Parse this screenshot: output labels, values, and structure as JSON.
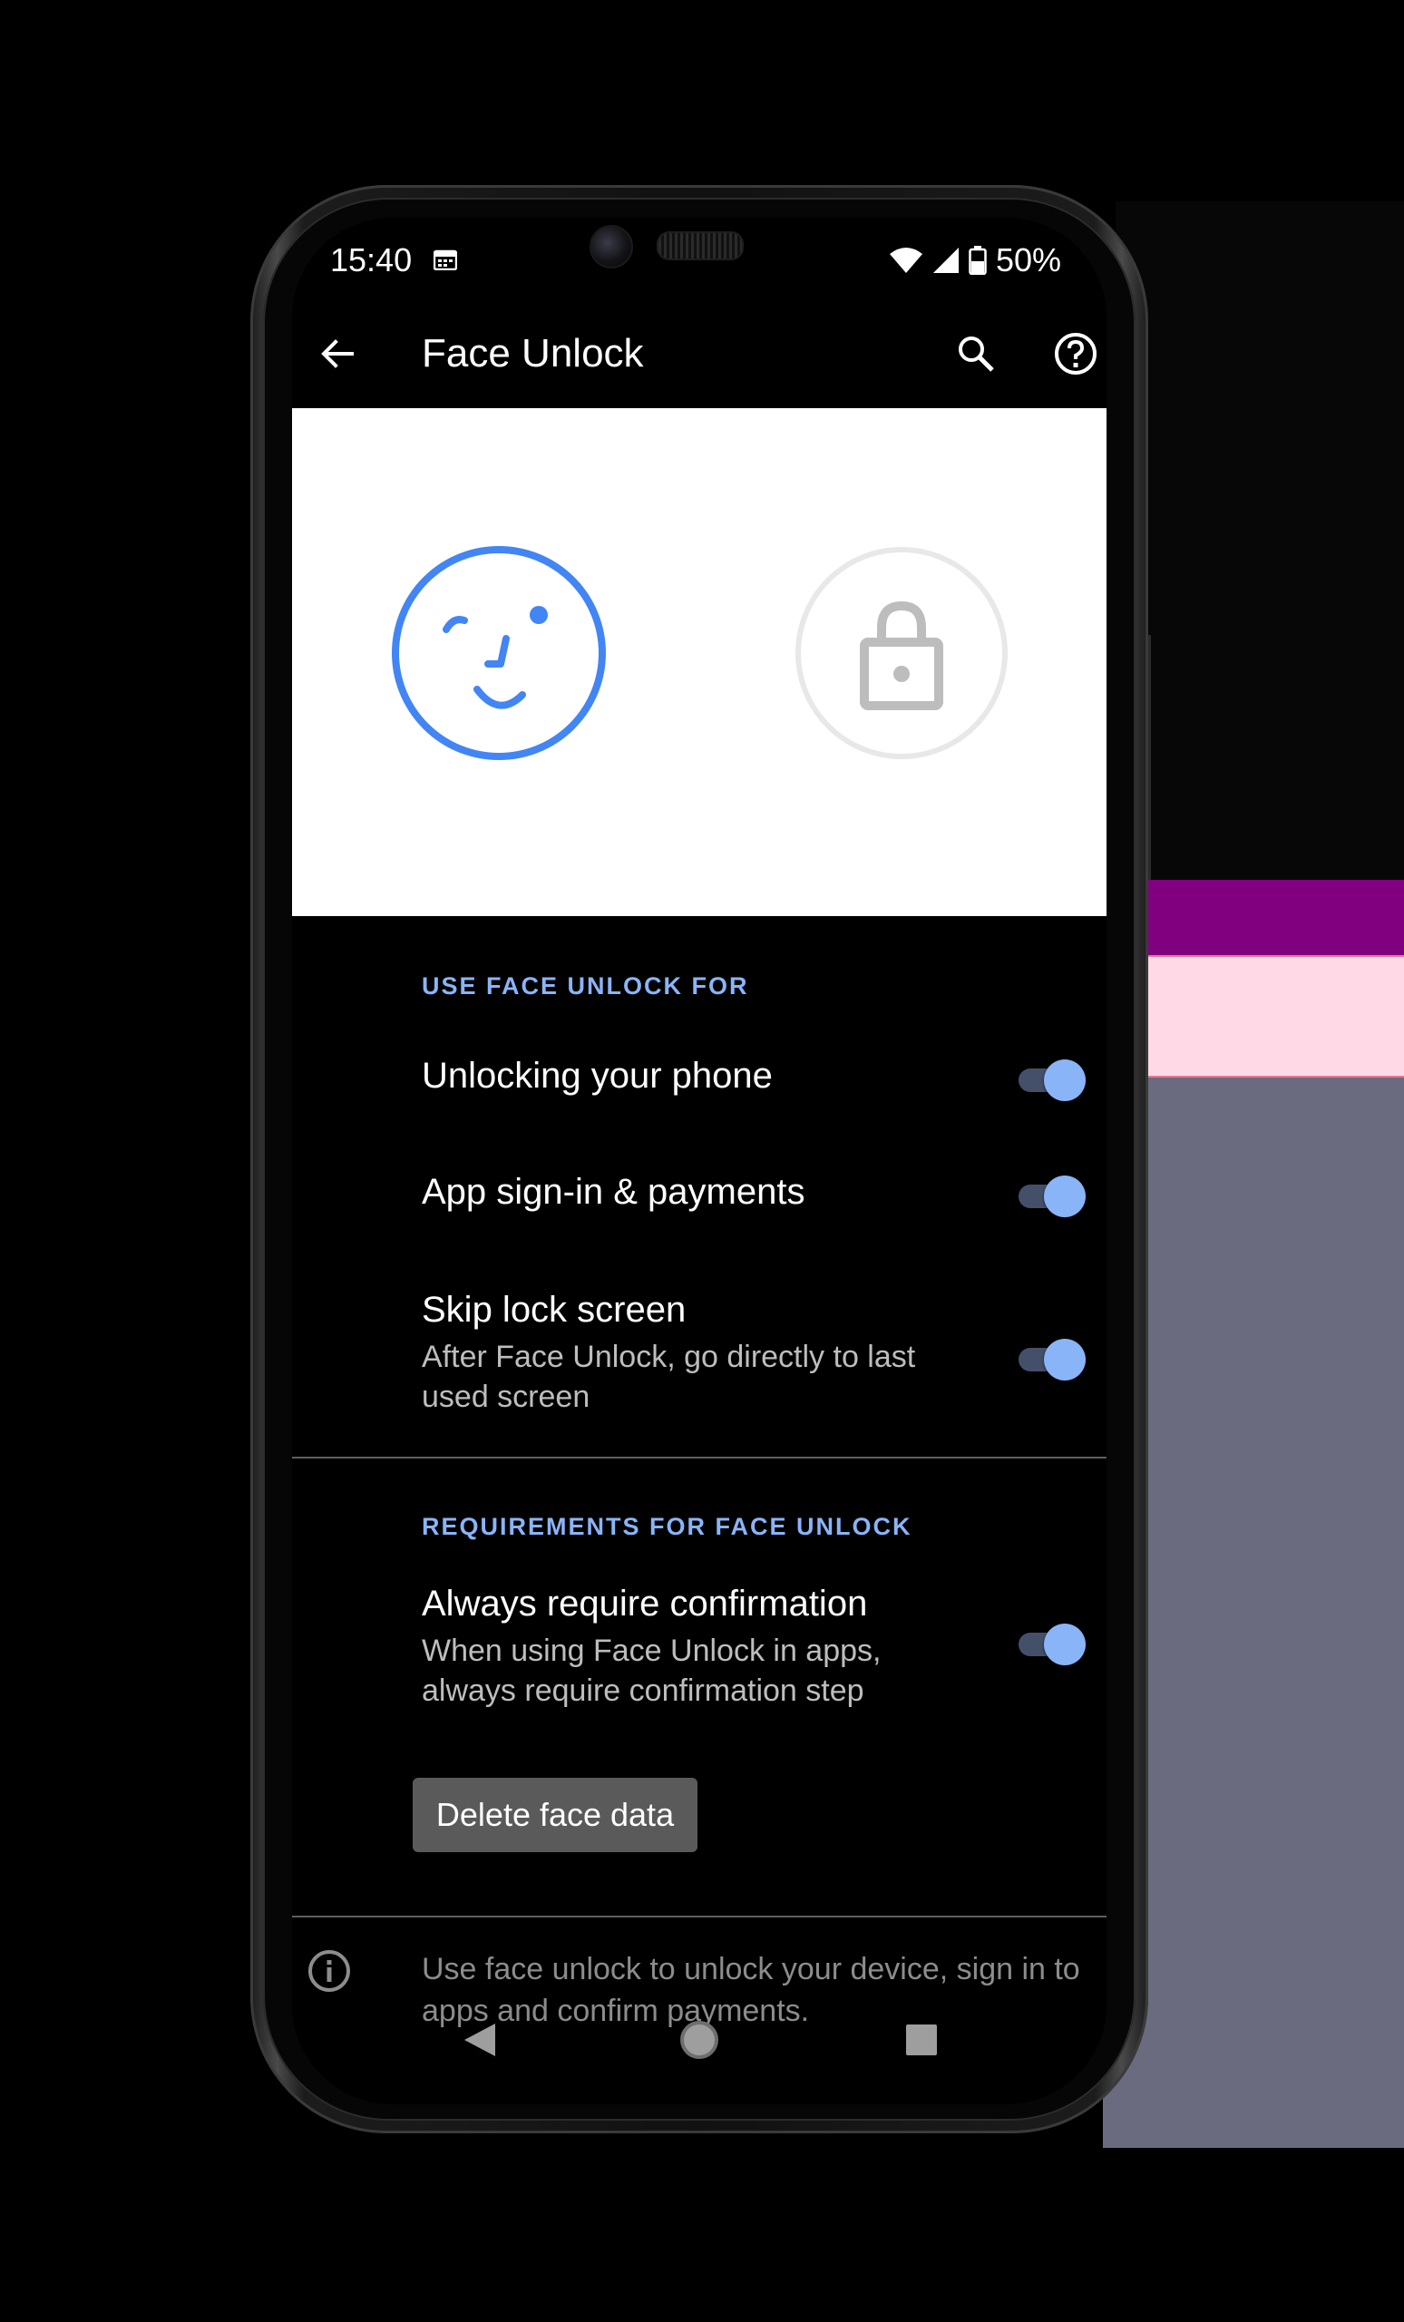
{
  "status_bar": {
    "time": "15:40",
    "battery": "50%",
    "icons": [
      "calendar-icon",
      "wifi-icon",
      "signal-icon",
      "battery-icon"
    ]
  },
  "app_bar": {
    "title": "Face Unlock",
    "icons": [
      "back-arrow-icon",
      "search-icon",
      "help-icon"
    ]
  },
  "illustration": {
    "icons": [
      "face-icon",
      "lock-icon"
    ],
    "accent_color": "#4285f4",
    "muted_color": "#e8e8ea"
  },
  "section_use": {
    "header": "USE FACE UNLOCK FOR",
    "items": [
      {
        "title": "Unlocking your phone",
        "subtitle": "",
        "enabled": true
      },
      {
        "title": "App sign-in & payments",
        "subtitle": "",
        "enabled": true
      },
      {
        "title": "Skip lock screen",
        "subtitle": "After Face Unlock, go directly to last used screen",
        "enabled": true
      }
    ]
  },
  "section_requirements": {
    "header": "REQUIREMENTS FOR FACE UNLOCK",
    "items": [
      {
        "title": "Always require confirmation",
        "subtitle": "When using Face Unlock in apps, always require confirmation step",
        "enabled": true
      }
    ],
    "delete_button_label": "Delete face data"
  },
  "footer": {
    "info_text": "Use face unlock to unlock your device, sign in to apps and confirm payments."
  },
  "nav_bar": {
    "icons": [
      "nav-back-icon",
      "nav-home-icon",
      "nav-recents-icon"
    ]
  },
  "colors": {
    "accent": "#8ab4f8",
    "background": "#000000",
    "bg_purple": "#800080",
    "bg_pink": "#ffd9e6",
    "bg_gray": "#6b6b80"
  }
}
